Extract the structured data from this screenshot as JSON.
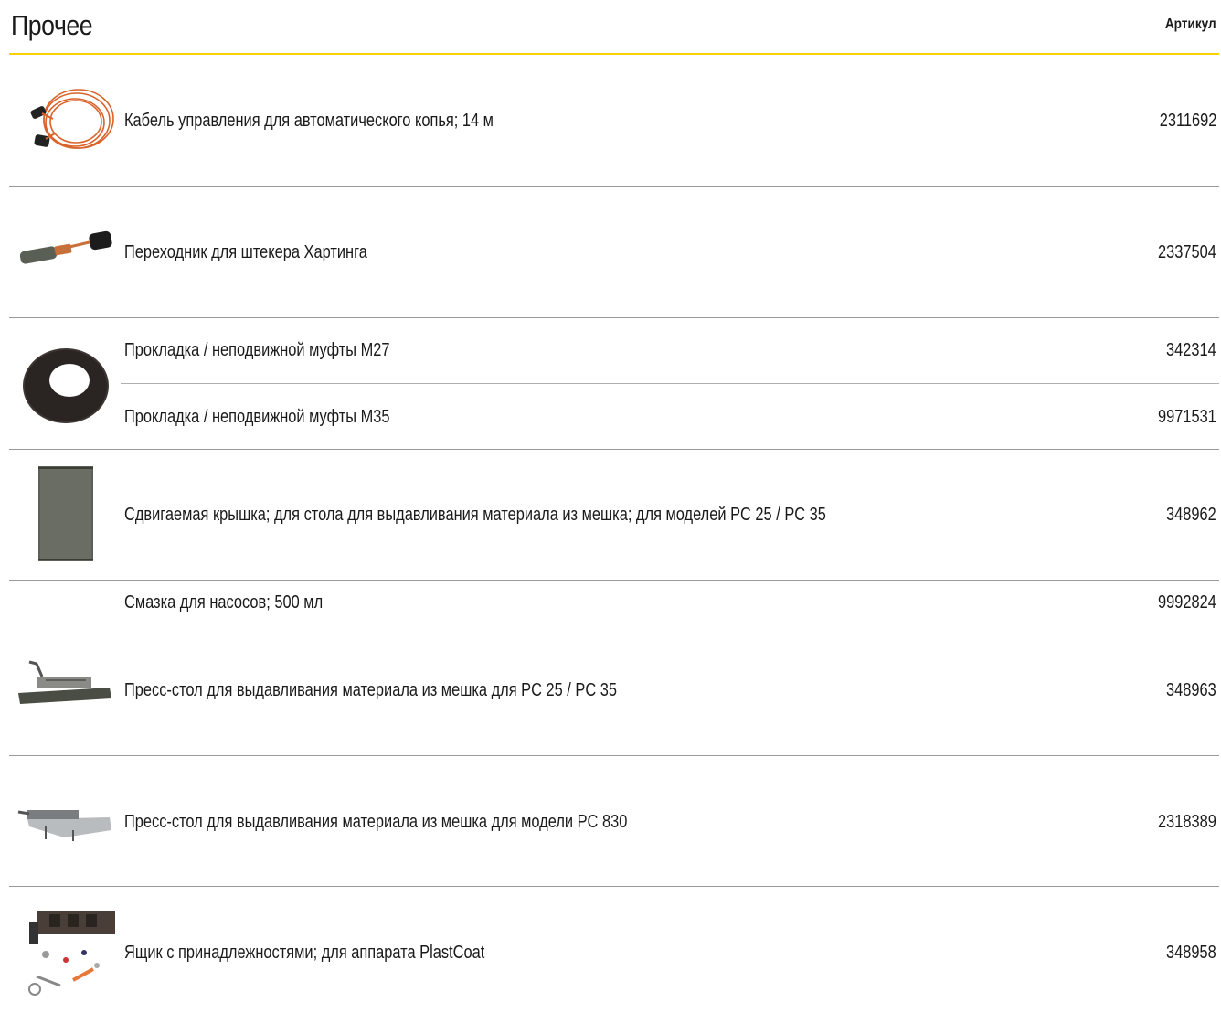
{
  "header": {
    "title": "Прочее",
    "column_label": "Артикул"
  },
  "rows": [
    {
      "description": "Кабель управления для автоматического копья; 14 м",
      "article": "2311692",
      "image": "control-cable-image"
    },
    {
      "description": "Переходник для штекера Хартинга",
      "article": "2337504",
      "image": "harting-adapter-image"
    },
    {
      "description": "Прокладка / неподвижной муфты M27",
      "article": "342314",
      "image": "gasket-image"
    },
    {
      "description": "Прокладка / неподвижной муфты M35",
      "article": "9971531"
    },
    {
      "description": "Сдвигаемая крышка; для стола для выдавливания материала из мешка; для моделей PC 25 / PC 35",
      "article": "348962",
      "image": "sliding-cover-image"
    },
    {
      "description": "Смазка для насосов; 500 мл",
      "article": "9992824"
    },
    {
      "description": "Пресс-стол для выдавливания материала из мешка для PC 25 / PC 35",
      "article": "348963",
      "image": "press-table-image"
    },
    {
      "description": "Пресс-стол для выдавливания материала из мешка для модели PC 830",
      "article": "2318389",
      "image": "press-table-pc830-image"
    },
    {
      "description": "Ящик с принадлежностями; для аппарата PlastCoat",
      "article": "348958",
      "image": "accessory-box-image"
    }
  ],
  "colors": {
    "accent_rule": "#ffd000",
    "divider": "#9a9a9a"
  }
}
